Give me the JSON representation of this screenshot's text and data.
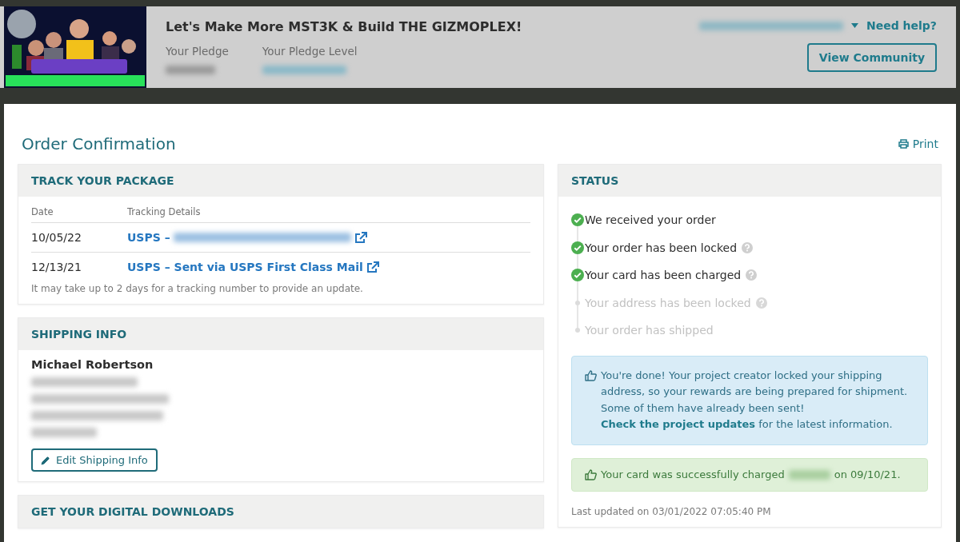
{
  "header": {
    "campaign_title": "Let's Make More MST3K & Build THE GIZMOPLEX!",
    "pledge_label": "Your Pledge",
    "pledge_level_label": "Your Pledge Level",
    "help_link": "Need help?",
    "community_button": "View Community"
  },
  "page": {
    "title": "Order Confirmation",
    "print_link": "Print"
  },
  "track_package": {
    "heading": "TRACK YOUR PACKAGE",
    "columns": [
      "Date",
      "Tracking Details"
    ],
    "rows": [
      {
        "date": "10/05/22",
        "link": "USPS –",
        "redacted": true
      },
      {
        "date": "12/13/21",
        "link": "USPS – Sent via USPS First Class Mail",
        "redacted": false
      }
    ],
    "note": "It may take up to 2 days for a tracking number to provide an update."
  },
  "shipping_info": {
    "heading": "SHIPPING INFO",
    "name": "Michael Robertson",
    "edit_button": "Edit Shipping Info"
  },
  "digital_downloads": {
    "heading": "GET YOUR DIGITAL DOWNLOADS"
  },
  "status": {
    "heading": "STATUS",
    "items": [
      {
        "label": "We received your order",
        "done": true,
        "help": false
      },
      {
        "label": "Your order has been locked",
        "done": true,
        "help": true
      },
      {
        "label": "Your card has been charged",
        "done": true,
        "help": true
      },
      {
        "label": "Your address has been locked",
        "done": false,
        "help": true
      },
      {
        "label": "Your order has shipped",
        "done": false,
        "help": false
      }
    ],
    "info_alert": {
      "text": "You're done! Your project creator locked your shipping address, so your rewards are being prepared for shipment. Some of them have already been sent!",
      "link": "Check the project updates",
      "after": "for the latest information."
    },
    "success_alert": {
      "text": "Your card was successfully charged",
      "after": "on 09/10/21."
    },
    "last_updated": "Last updated on 03/01/2022 07:05:40 PM"
  }
}
